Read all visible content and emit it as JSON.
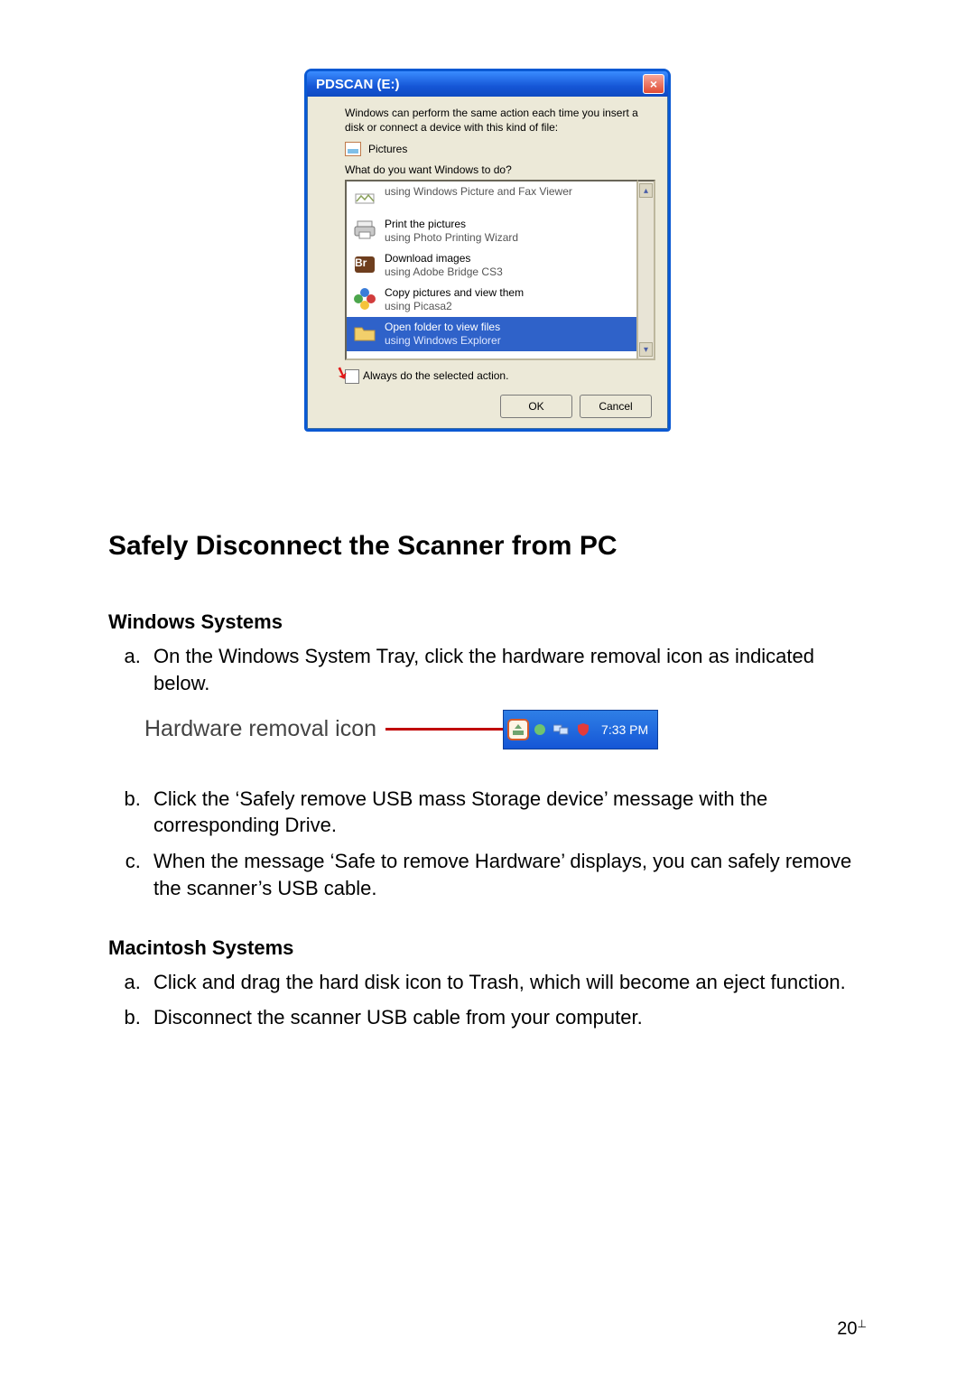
{
  "dialog": {
    "title": "PDSCAN (E:)",
    "intro": "Windows can perform the same action each time you insert a disk or connect a device with this kind of file:",
    "file_type_label": "Pictures",
    "prompt": "What do you want Windows to do?",
    "items": [
      {
        "line1": "",
        "line2": "using Windows Picture and Fax Viewer"
      },
      {
        "line1": "Print the pictures",
        "line2": "using Photo Printing Wizard"
      },
      {
        "line1": "Download images",
        "line2": "using Adobe Bridge CS3"
      },
      {
        "line1": "Copy pictures and view them",
        "line2": "using Picasa2"
      },
      {
        "line1": "Open folder to view files",
        "line2": "using Windows Explorer"
      }
    ],
    "always_label": "Always do the selected action.",
    "ok": "OK",
    "cancel": "Cancel"
  },
  "doc": {
    "heading": "Safely Disconnect the Scanner from PC",
    "win_heading": "Windows Systems",
    "win_a": "On the Windows System Tray, click the hardware removal icon as indicated below.",
    "tray_label": "Hardware removal icon",
    "tray_time": "7:33 PM",
    "win_b": "Click the ‘Safely remove USB mass Storage device’ message with the corresponding Drive.",
    "win_c": "When the message ‘Safe to remove Hardware’ displays, you can safely remove the scanner’s USB cable.",
    "mac_heading": "Macintosh Systems",
    "mac_a": "Click and drag the hard disk icon to Trash, which will become an eject function.",
    "mac_b": "Disconnect the scanner USB cable from your computer.",
    "page_number": "20"
  }
}
